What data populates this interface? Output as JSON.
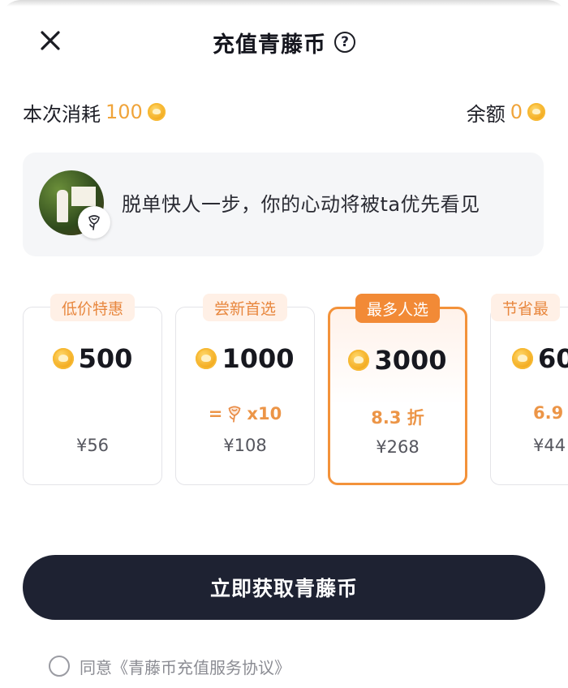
{
  "header": {
    "title": "充值青藤币",
    "help_glyph": "?",
    "close_icon": "close-icon"
  },
  "consume": {
    "label": "本次消耗",
    "value": "100",
    "coin_icon": "coin-icon"
  },
  "balance": {
    "label": "余额",
    "value": "0",
    "coin_icon": "coin-icon"
  },
  "banner": {
    "text": "脱单快人一步，你的心动将被ta优先看见",
    "badge_icon": "rose-icon"
  },
  "packages": [
    {
      "tag": "低价特惠",
      "amount": "500",
      "perk": "",
      "price": "¥56",
      "selected": false
    },
    {
      "tag": "尝新首选",
      "amount": "1000",
      "perk_prefix": "=",
      "perk": "x10",
      "perk_icon": "rose-icon",
      "price": "¥108",
      "selected": false
    },
    {
      "tag": "最多人选",
      "amount": "3000",
      "perk": "8.3 折",
      "price": "¥268",
      "selected": true
    },
    {
      "tag": "节省最",
      "amount": "60",
      "perk": "6.9",
      "price": "¥44",
      "selected": false
    }
  ],
  "cta": {
    "label": "立即获取青藤币"
  },
  "agreement": {
    "text": "同意《青藤币充值服务协议》",
    "checked": false
  },
  "colors": {
    "accent_orange": "#f28a36",
    "coin_gold": "#f2a81b",
    "cta_dark": "#1e2232"
  }
}
